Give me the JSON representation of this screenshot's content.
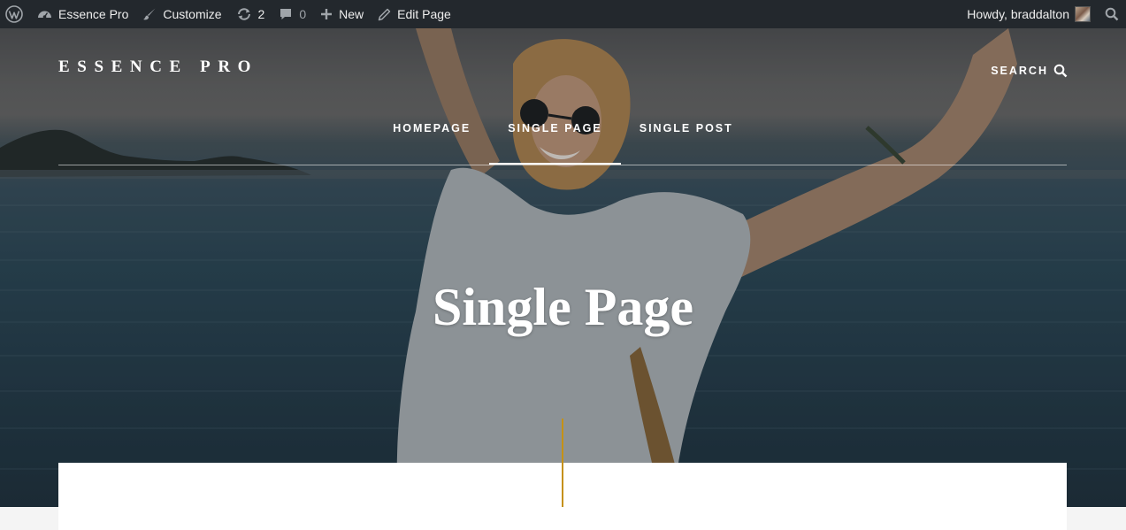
{
  "adminbar": {
    "site_name": "Essence Pro",
    "customize": "Customize",
    "updates_count": "2",
    "comments_count": "0",
    "new": "New",
    "edit_page": "Edit Page",
    "howdy": "Howdy, braddalton",
    "icons": [
      "wordpress-logo-icon",
      "dashboard-icon",
      "brush-icon",
      "updates-icon",
      "comment-icon",
      "plus-icon",
      "pencil-icon",
      "search-icon"
    ]
  },
  "site": {
    "title": "ESSENCE PRO",
    "search_label": "SEARCH"
  },
  "nav": {
    "items": [
      {
        "label": "HOMEPAGE"
      },
      {
        "label": "SINGLE PAGE"
      },
      {
        "label": "SINGLE POST"
      }
    ],
    "current": "SINGLE PAGE"
  },
  "hero": {
    "title": "Single Page"
  },
  "colors": {
    "adminbar_bg": "#23282d",
    "accent": "#c59116",
    "text_on_hero": "#ffffff",
    "page_bg": "#f4f4f4"
  }
}
